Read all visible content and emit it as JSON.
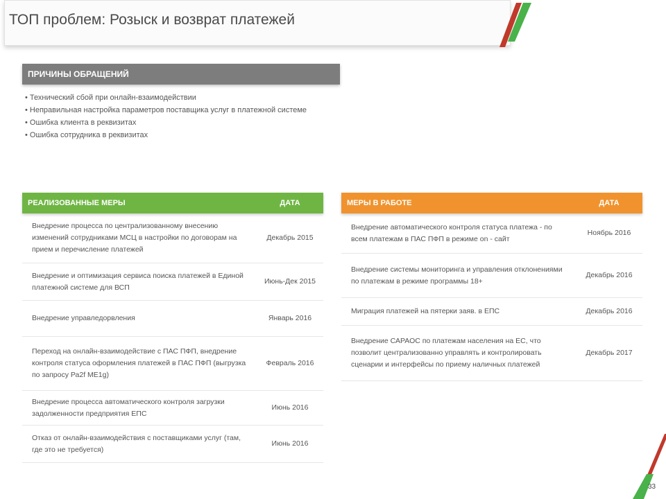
{
  "header": {
    "title": "ТОП проблем: Розыск и возврат платежей"
  },
  "reasons": {
    "heading": "ПРИЧИНЫ ОБРАЩЕНИЙ",
    "items": [
      "• Технический сбой при онлайн-взаимодействии",
      "• Неправильная настройка параметров поставщика услуг в платежной системе",
      "• Ошибка клиента в реквизитах",
      "• Ошибка сотрудника в реквизитах"
    ]
  },
  "implemented": {
    "header_measure": "РЕАЛИЗОВАННЫЕ МЕРЫ",
    "header_date": "ДАТА",
    "rows": [
      {
        "measure": "Внедрение процесса по централизованному внесению изменений сотрудниками МСЦ в настройки по договорам на прием и перечисление платежей",
        "date": "Декабрь 2015"
      },
      {
        "measure": "Внедрение и оптимизация сервиса поиска платежей в Единой платежной системе для ВСП",
        "date": "Июнь-Дек 2015"
      },
      {
        "measure": "Внедрение управледорвления",
        "date": "Январь 2016"
      },
      {
        "measure": "Переход на онлайн-взаимодействие с ПАС ПФП, внедрение контроля статуса оформления платежей в ПАС ПФП (выгрузка по запросу Ра2f ME1g)",
        "date": "Февраль 2016"
      },
      {
        "measure": "Внедрение процесса автоматического контроля загрузки задолженности предприятия ЕПС",
        "date": "Июнь 2016"
      },
      {
        "measure": "Отказ от онлайн-взаимодействия с поставщиками услуг (там, где это не требуется)",
        "date": "Июнь 2016"
      }
    ]
  },
  "in_progress": {
    "header_measure": "МЕРЫ В РАБОТЕ",
    "header_date": "ДАТА",
    "rows": [
      {
        "measure": "Внедрение автоматического контроля статуса платежа - по всем платежам в ПАС ПФП в режиме on - сайт",
        "date": "Ноябрь 2016"
      },
      {
        "measure": "Внедрение системы мониторинга и управления отклонениями по платежам в режиме программы 18+",
        "date": "Декабрь 2016"
      },
      {
        "measure": "Миграция платежей на пятерки заяв. в ЕПС",
        "date": "Декабрь 2016"
      },
      {
        "measure": "Внедрение САРАОС по платежам населения на ЕС, что позволит централизованно управлять и контролировать сценарии и интерфейсы по приему наличных платежей",
        "date": "Декабрь 2017"
      }
    ]
  },
  "page_number": "33",
  "colors": {
    "reasons_header": "#7d7d7d",
    "implemented_header": "#6fb544",
    "in_progress_header": "#f0932e",
    "deco_green": "#49b24a",
    "deco_red": "#c0392b"
  }
}
